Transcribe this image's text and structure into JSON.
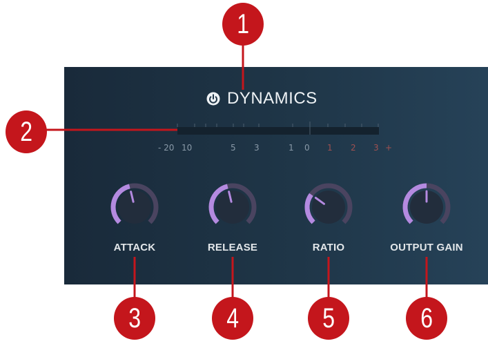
{
  "panel": {
    "title": "DYNAMICS",
    "power_icon": "power-icon"
  },
  "meter": {
    "scale": [
      "- 20",
      "10",
      "5",
      "3",
      "1",
      "0",
      "1",
      "2",
      "3",
      "+"
    ]
  },
  "knobs": [
    {
      "label": "ATTACK",
      "value": 0.45
    },
    {
      "label": "RELEASE",
      "value": 0.45
    },
    {
      "label": "RATIO",
      "value": 0.3
    },
    {
      "label": "OUTPUT GAIN",
      "value": 0.5
    }
  ],
  "callouts": [
    "1",
    "2",
    "3",
    "4",
    "5",
    "6"
  ],
  "colors": {
    "callout": "#c4161c",
    "knob_accent": "#b48ae0",
    "knob_track": "#4a4460",
    "meter_hot": "#a05151"
  }
}
